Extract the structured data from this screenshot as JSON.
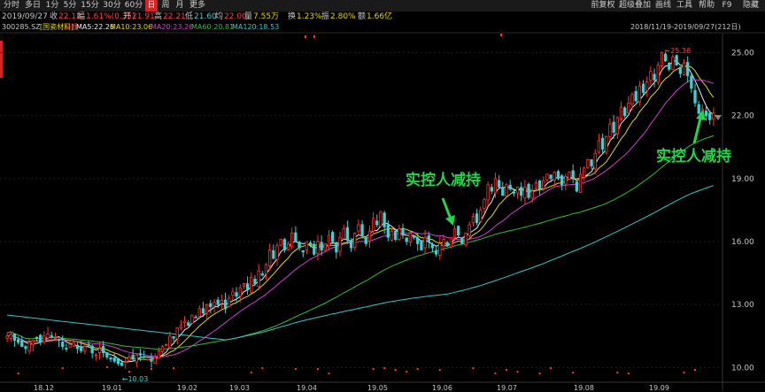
{
  "toolbar": {
    "left_tabs": [
      "分时",
      "多日",
      "1分",
      "5分",
      "15分",
      "30分",
      "60分",
      "日",
      "周",
      "月",
      "更多"
    ],
    "active_tab": "日",
    "right_buttons": [
      "前复权",
      "超级叠加",
      "画线",
      "工具",
      "帮助",
      "F9",
      "隐藏"
    ]
  },
  "info": {
    "date": "2019/09/27",
    "close_label": "收",
    "close": "22.12",
    "change_label": "幅",
    "change": "1.61%(0.35)",
    "open_label": "开",
    "open": "21.91",
    "high_label": "高",
    "high": "22.21",
    "low_label": "低",
    "low": "21.60",
    "avg_label": "均",
    "avg": "22.00",
    "volume_label": "量",
    "volume": "7.55万",
    "turnover_label": "换",
    "turnover": "1.23%",
    "amplitude_label": "振",
    "amplitude": "2.80%",
    "amount_label": "额",
    "amount": "1.66亿"
  },
  "ma": {
    "code": "300285.SZ",
    "name": "[国瓷材料]",
    "period": "日线",
    "ma5": "MA5:22.26",
    "ma10": "MA10:23.06",
    "ma20": "MA20:23.26",
    "ma60": "MA60:20.81",
    "ma120": "MA120:18.53",
    "range": "2018/11/19-2019/09/27(212日)"
  },
  "colors": {
    "up": "#ff3333",
    "down": "#3fd0d0",
    "ma5": "#f0f0f0",
    "ma10": "#e8d800",
    "ma20": "#d040d0",
    "ma60": "#30c030",
    "ma120": "#30c8c8",
    "annotation": "#27d34a"
  },
  "annotations": [
    "实控人减持",
    "实控人减持"
  ],
  "chart_data": {
    "type": "candlestick",
    "y_ticks": [
      "25.00",
      "22.00",
      "19.00",
      "16.00",
      "13.00",
      "10.00"
    ],
    "ylim": [
      9.3,
      25.9
    ],
    "x_ticks": [
      "18.12",
      "19.01",
      "19.02",
      "19.03",
      "19.04",
      "19.05",
      "19.06",
      "19.07",
      "19.08",
      "19.09"
    ],
    "max_label": "25.36",
    "min_label": "10.03",
    "closes": [
      11.5,
      11.6,
      11.3,
      11.2,
      11.0,
      10.9,
      11.2,
      11.3,
      11.4,
      11.2,
      11.5,
      11.6,
      11.5,
      11.4,
      11.3,
      11.0,
      10.9,
      11.1,
      11.2,
      10.9,
      10.8,
      11.0,
      11.1,
      10.7,
      10.6,
      10.9,
      10.7,
      10.5,
      10.4,
      10.3,
      10.2,
      10.1,
      10.3,
      10.5,
      10.4,
      10.6,
      10.6,
      10.5,
      10.4,
      10.3,
      10.5,
      10.8,
      11.0,
      11.1,
      11.5,
      11.4,
      11.9,
      12.0,
      12.2,
      12.0,
      12.5,
      12.4,
      12.8,
      12.6,
      13.0,
      12.9,
      13.1,
      13.0,
      13.2,
      12.8,
      13.3,
      13.6,
      13.4,
      13.8,
      14.0,
      13.7,
      14.3,
      14.0,
      14.6,
      14.4,
      14.9,
      15.6,
      15.2,
      15.8,
      16.1,
      15.6,
      15.9,
      16.4,
      16.0,
      15.7,
      15.5,
      16.0,
      15.8,
      15.4,
      16.0,
      15.6,
      15.9,
      16.3,
      16.0,
      15.5,
      16.2,
      16.6,
      16.1,
      15.7,
      16.4,
      16.8,
      16.3,
      15.9,
      16.5,
      17.1,
      16.8,
      17.4,
      16.7,
      16.2,
      16.5,
      16.1,
      16.6,
      16.3,
      16.0,
      16.4,
      16.2,
      15.9,
      15.6,
      16.2,
      16.0,
      15.7,
      15.4,
      15.9,
      16.1,
      15.8,
      16.2,
      16.6,
      16.3,
      15.9,
      16.4,
      16.8,
      17.2,
      16.9,
      17.5,
      18.0,
      18.7,
      18.4,
      19.0,
      18.6,
      18.2,
      18.7,
      18.5,
      18.3,
      18.6,
      18.2,
      18.6,
      18.1,
      18.4,
      18.8,
      18.5,
      18.9,
      19.2,
      19.0,
      19.3,
      19.0,
      18.7,
      19.1,
      19.3,
      19.0,
      18.4,
      19.2,
      19.5,
      19.9,
      19.6,
      20.2,
      20.8,
      20.4,
      21.0,
      21.6,
      21.2,
      21.9,
      22.4,
      22.0,
      22.6,
      23.0,
      22.7,
      23.4,
      23.1,
      23.6,
      24.1,
      23.7,
      24.4,
      25.0,
      24.6,
      24.2,
      24.8,
      24.4,
      24.0,
      24.5,
      23.9,
      23.3,
      22.6,
      22.1,
      22.3,
      22.0,
      21.8,
      22.12
    ]
  }
}
